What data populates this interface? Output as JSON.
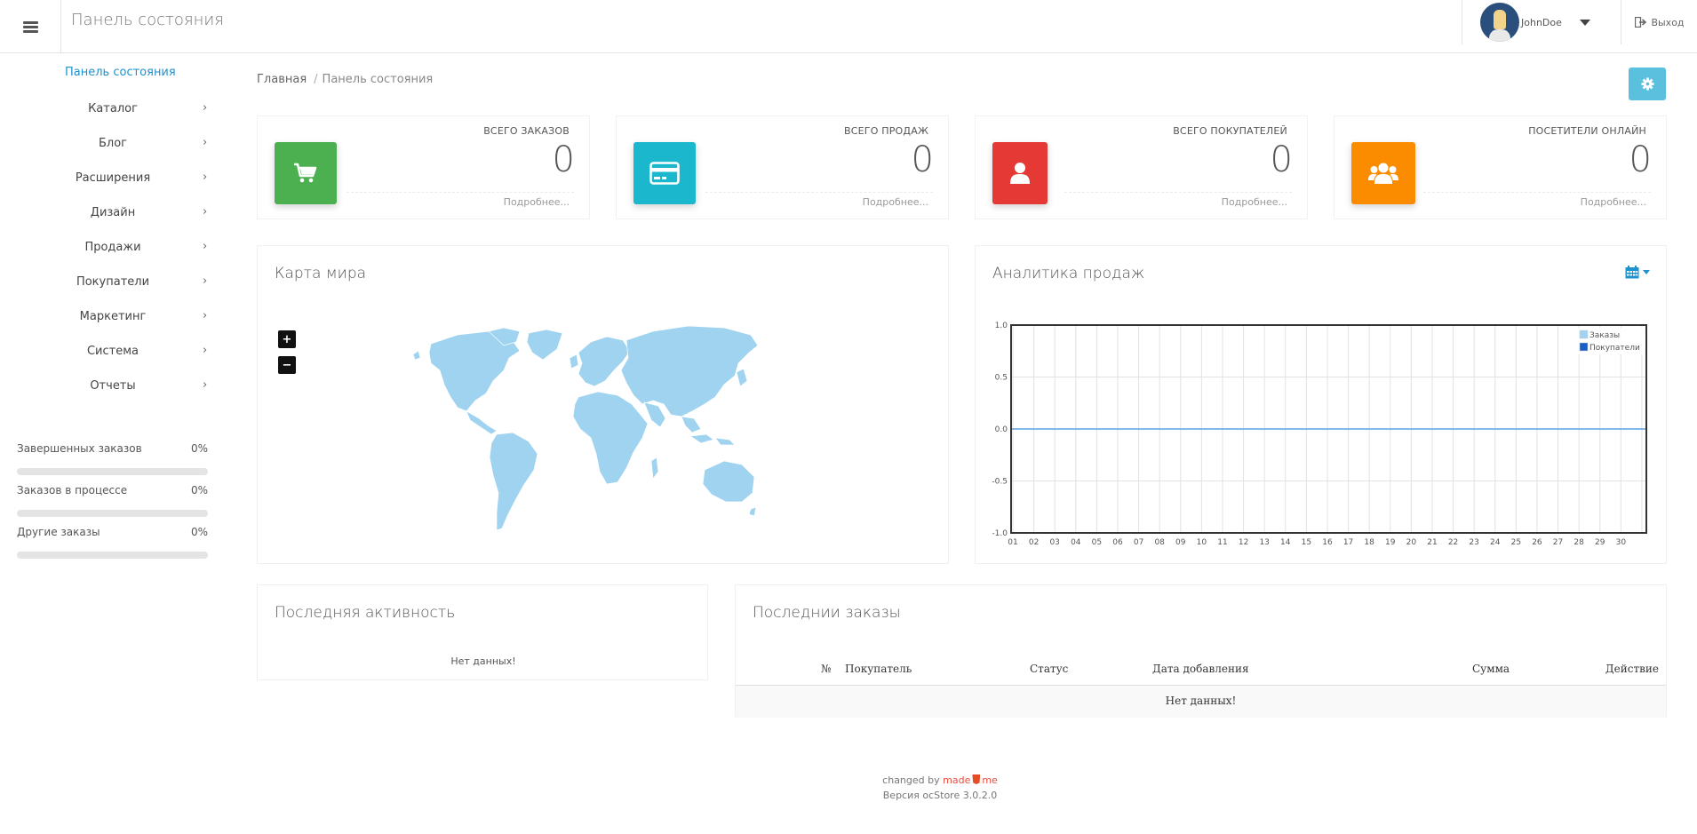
{
  "header": {
    "title": "Панель состояния",
    "username": "JohnDoe",
    "logout_label": "Выход"
  },
  "sidebar": {
    "active_item": "Панель состояния",
    "items": [
      {
        "label": "Каталог"
      },
      {
        "label": "Блог"
      },
      {
        "label": "Расширения"
      },
      {
        "label": "Дизайн"
      },
      {
        "label": "Продажи"
      },
      {
        "label": "Покупатели"
      },
      {
        "label": "Маркетинг"
      },
      {
        "label": "Система"
      },
      {
        "label": "Отчеты"
      }
    ],
    "chevron": "›",
    "stats": [
      {
        "label": "Завершенных заказов",
        "value": "0%",
        "fraction": 0
      },
      {
        "label": "Заказов в процессе",
        "value": "0%",
        "fraction": 0
      },
      {
        "label": "Другие заказы",
        "value": "0%",
        "fraction": 0
      }
    ]
  },
  "breadcrumb": {
    "home": "Главная",
    "separator": "/",
    "current": "Панель состояния"
  },
  "tiles": [
    {
      "title": "ВСЕГО ЗАКАЗОВ",
      "value": "0",
      "more": "Подробнее...",
      "color": "#4caf50",
      "icon": "shopping-cart-icon"
    },
    {
      "title": "ВСЕГО ПРОДАЖ",
      "value": "0",
      "more": "Подробнее...",
      "color": "#1bb7cd",
      "icon": "credit-card-icon"
    },
    {
      "title": "ВСЕГО ПОКУПАТЕЛЕЙ",
      "value": "0",
      "more": "Подробнее...",
      "color": "#e53935",
      "icon": "user-icon"
    },
    {
      "title": "ПОСЕТИТЕЛИ ОНЛАЙН",
      "value": "0",
      "more": "Подробнее...",
      "color": "#fb8c00",
      "icon": "users-icon"
    }
  ],
  "map_panel": {
    "title": "Карта мира",
    "zoom_in": "+",
    "zoom_out": "−",
    "land_color": "#9fd3f0"
  },
  "sales_panel": {
    "title": "Аналитика продаж"
  },
  "chart_data": {
    "type": "line",
    "x": [
      "01",
      "02",
      "03",
      "04",
      "05",
      "06",
      "07",
      "08",
      "09",
      "10",
      "11",
      "12",
      "13",
      "14",
      "15",
      "16",
      "17",
      "18",
      "19",
      "20",
      "21",
      "22",
      "23",
      "24",
      "25",
      "26",
      "27",
      "28",
      "29",
      "30"
    ],
    "series": [
      {
        "name": "Заказы",
        "color": "#9fd3f0",
        "values": [
          0,
          0,
          0,
          0,
          0,
          0,
          0,
          0,
          0,
          0,
          0,
          0,
          0,
          0,
          0,
          0,
          0,
          0,
          0,
          0,
          0,
          0,
          0,
          0,
          0,
          0,
          0,
          0,
          0,
          0
        ]
      },
      {
        "name": "Покупатели",
        "color": "#1a5fc4",
        "values": [
          0,
          0,
          0,
          0,
          0,
          0,
          0,
          0,
          0,
          0,
          0,
          0,
          0,
          0,
          0,
          0,
          0,
          0,
          0,
          0,
          0,
          0,
          0,
          0,
          0,
          0,
          0,
          0,
          0,
          0
        ]
      }
    ],
    "y_ticks": [
      "1.0",
      "0.5",
      "0.0",
      "-0.5",
      "-1.0"
    ],
    "ylim": [
      -1,
      1
    ],
    "grid": true,
    "legend": "top-right"
  },
  "activity_panel": {
    "title": "Последняя активность",
    "empty": "Нет данных!"
  },
  "orders_panel": {
    "title": "Последнии заказы",
    "columns": [
      "№",
      "Покупатель",
      "Статус",
      "Дата добавления",
      "Сумма",
      "Действие"
    ],
    "empty": "Нет данных!"
  },
  "footer": {
    "changed_by": "changed by",
    "made": "made",
    "me": "me",
    "version": "Версия ocStore 3.0.2.0"
  }
}
